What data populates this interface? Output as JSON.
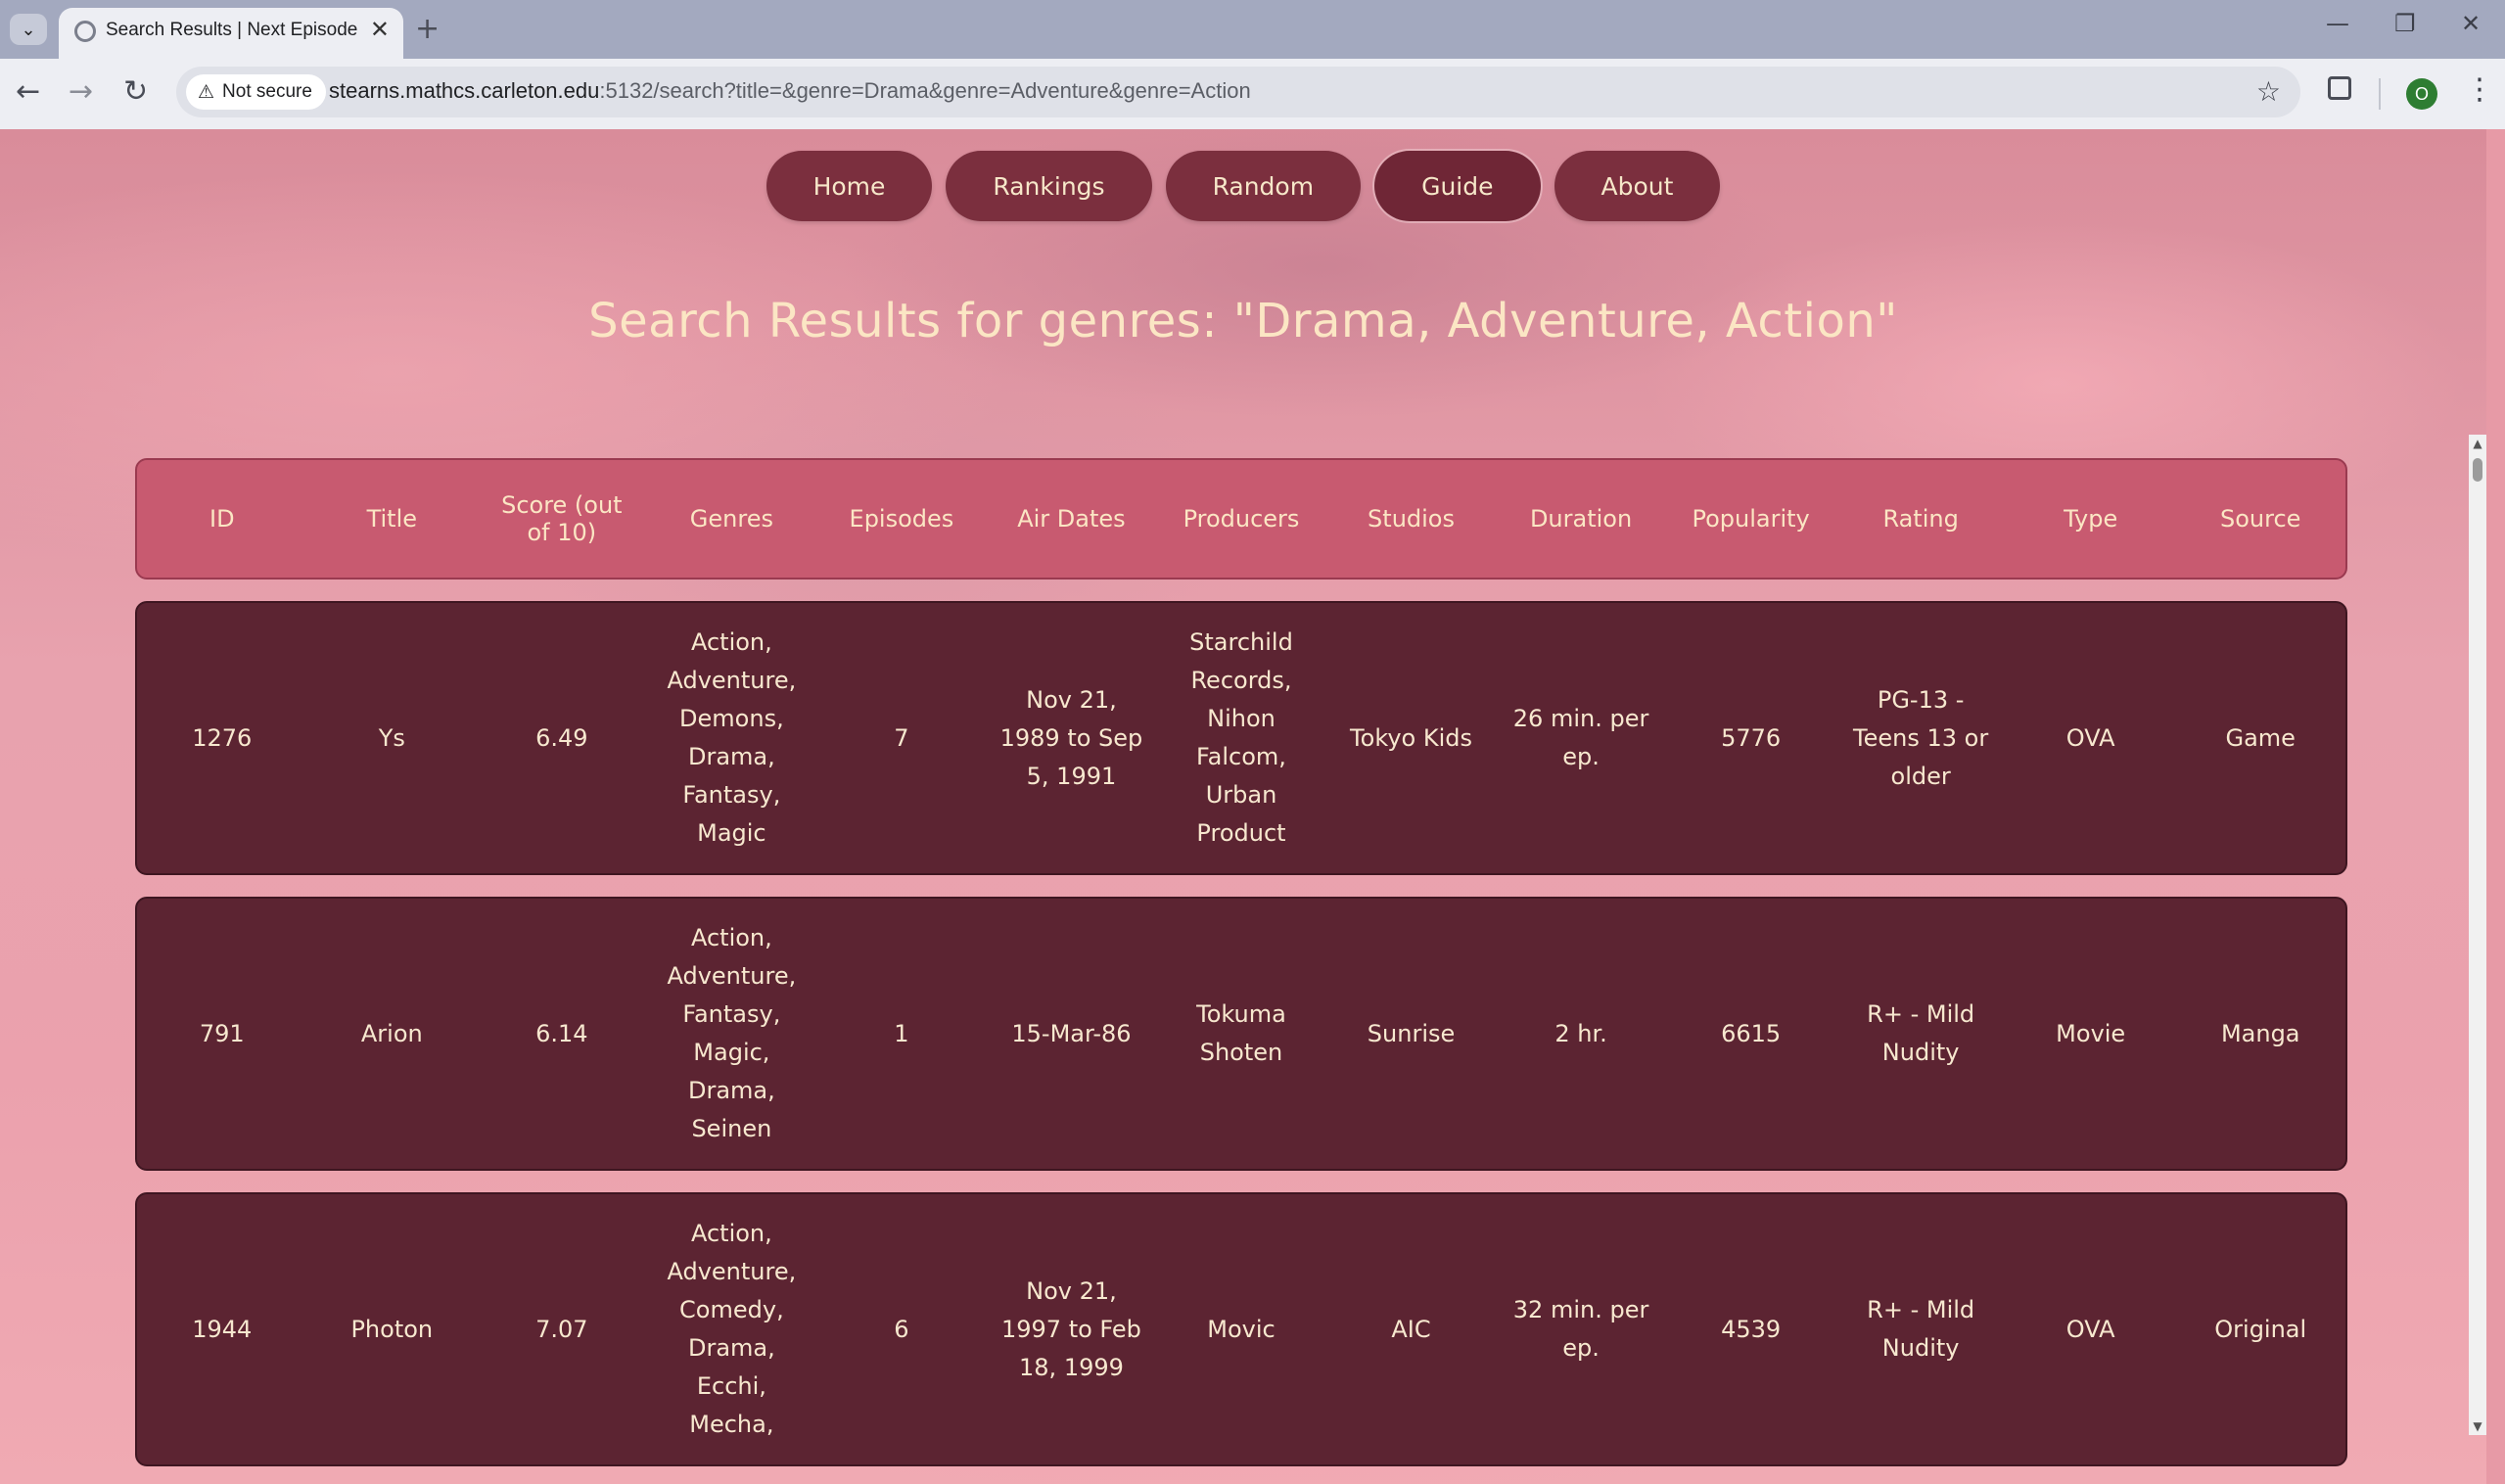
{
  "browser": {
    "tab_title": "Search Results | Next Episode",
    "close_glyph": "✕",
    "new_tab_glyph": "+",
    "not_secure_label": "Not secure",
    "url_host": "stearns.mathcs.carleton.edu",
    "url_rest": ":5132/search?title=&genre=Drama&genre=Adventure&genre=Action",
    "profile_initial": "O"
  },
  "nav": {
    "items": [
      "Home",
      "Rankings",
      "Random",
      "Guide",
      "About"
    ]
  },
  "page_title": "Search Results for genres: \"Drama, Adventure, Action\"",
  "table": {
    "headers": [
      "ID",
      "Title",
      "Score (out of 10)",
      "Genres",
      "Episodes",
      "Air Dates",
      "Producers",
      "Studios",
      "Duration",
      "Popularity",
      "Rating",
      "Type",
      "Source"
    ],
    "rows": [
      [
        "1276",
        "Ys",
        "6.49",
        "Action, Adventure, Demons, Drama, Fantasy, Magic",
        "7",
        "Nov 21, 1989 to Sep 5, 1991",
        "Starchild Records, Nihon Falcom, Urban Product",
        "Tokyo Kids",
        "26 min. per ep.",
        "5776",
        "PG-13 - Teens 13 or older",
        "OVA",
        "Game"
      ],
      [
        "791",
        "Arion",
        "6.14",
        "Action, Adventure, Fantasy, Magic, Drama, Seinen",
        "1",
        "15-Mar-86",
        "Tokuma Shoten",
        "Sunrise",
        "2 hr.",
        "6615",
        "R+ - Mild Nudity",
        "Movie",
        "Manga"
      ],
      [
        "1944",
        "Photon",
        "7.07",
        "Action, Adventure, Comedy, Drama, Ecchi, Mecha,",
        "6",
        "Nov 21, 1997 to Feb 18, 1999",
        "Movic",
        "AIC",
        "32 min. per ep.",
        "4539",
        "R+ - Mild Nudity",
        "OVA",
        "Original"
      ]
    ]
  },
  "colors": {
    "nav_button": "#7b2f3e",
    "header_row": "#c85a70",
    "data_row": "#5c2432",
    "title_text": "#fbe6c4"
  }
}
